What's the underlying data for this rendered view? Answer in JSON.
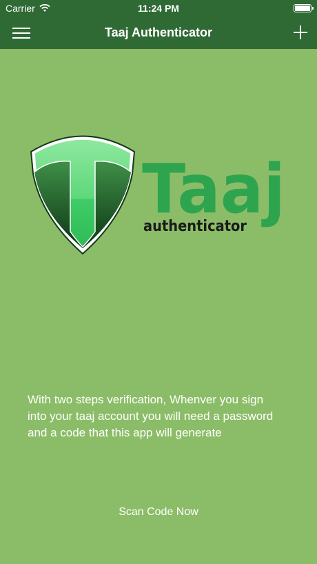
{
  "status_bar": {
    "carrier": "Carrier",
    "time": "11:24 PM",
    "icons": [
      "wifi-icon",
      "battery-icon"
    ]
  },
  "navbar": {
    "title": "Taaj Authenticator",
    "left_icon": "menu-icon",
    "right_icon": "plus-icon"
  },
  "logo": {
    "brand": "Taaj",
    "tagline": "authenticator",
    "shield_letter": "T",
    "colors": {
      "brand_green": "#2ea44f",
      "shield_green": "#4cd16f",
      "dark_text": "#1b1b1b"
    }
  },
  "main": {
    "description": "With two steps verification, Whenver you sign into your taaj account you will need a password and a code that this app will generate",
    "scan_button": "Scan Code Now"
  },
  "colors": {
    "background": "#8bbd68",
    "navbar": "#2f6a34",
    "text": "#ffffff"
  }
}
